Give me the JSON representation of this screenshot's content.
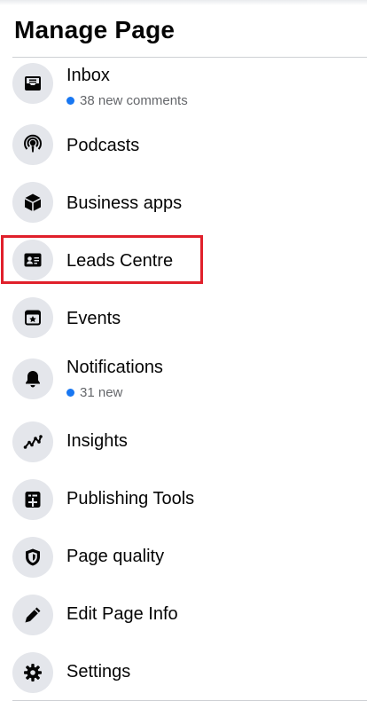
{
  "page": {
    "title": "Manage Page"
  },
  "menu": {
    "items": [
      {
        "label": "Inbox",
        "sub": "38 new comments",
        "icon": "inbox-icon"
      },
      {
        "label": "Podcasts",
        "icon": "podcast-icon"
      },
      {
        "label": "Business apps",
        "icon": "cube-icon"
      },
      {
        "label": "Leads Centre",
        "icon": "contact-card-icon"
      },
      {
        "label": "Events",
        "icon": "calendar-star-icon"
      },
      {
        "label": "Notifications",
        "sub": "31 new",
        "icon": "bell-icon"
      },
      {
        "label": "Insights",
        "icon": "line-chart-icon"
      },
      {
        "label": "Publishing Tools",
        "icon": "publishing-tools-icon"
      },
      {
        "label": "Page quality",
        "icon": "shield-icon"
      },
      {
        "label": "Edit Page Info",
        "icon": "pencil-icon"
      },
      {
        "label": "Settings",
        "icon": "gear-icon"
      }
    ]
  },
  "colors": {
    "highlight_border": "#e0202b",
    "badge_dot": "#1877f2",
    "icon_background": "#e4e6eb"
  }
}
